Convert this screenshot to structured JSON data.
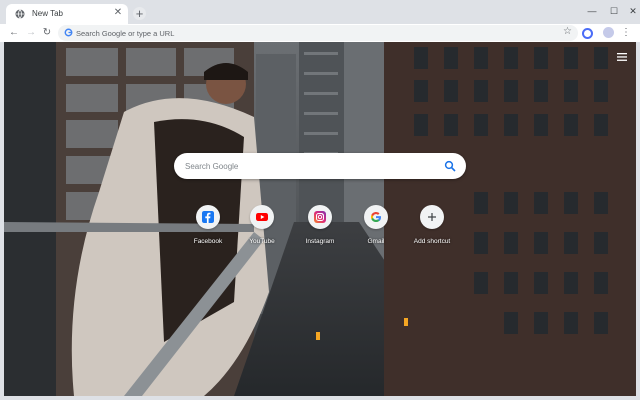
{
  "tabs": [
    {
      "title": "New Tab"
    }
  ],
  "omnibox": {
    "placeholder": "Search Google or type a URL"
  },
  "search": {
    "placeholder": "Search Google"
  },
  "shortcuts": [
    {
      "label": "Facebook",
      "icon": "facebook-icon",
      "color": "#1877f2"
    },
    {
      "label": "YouTube",
      "icon": "youtube-icon",
      "color": "#ff0000"
    },
    {
      "label": "Instagram",
      "icon": "instagram-icon",
      "color": "#c13584"
    },
    {
      "label": "Gmail",
      "icon": "google-icon",
      "color": "#4285f4"
    },
    {
      "label": "Add shortcut",
      "icon": "plus-icon",
      "color": "#3c4043"
    }
  ],
  "colors": {
    "accent": "#1a73e8",
    "tabstrip": "#dee1e6"
  }
}
